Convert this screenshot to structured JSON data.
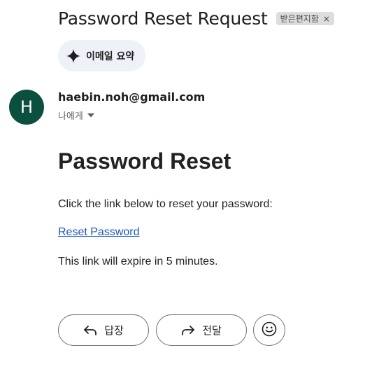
{
  "email": {
    "subject": "Password Reset Request",
    "label_chip": {
      "text": "받은편지함",
      "close_glyph": "×"
    },
    "summary_button": {
      "label": "이메일 요약",
      "icon": "sparkle-icon"
    },
    "sender": {
      "avatar_letter": "H",
      "avatar_color": "#0b4f3f",
      "email": "haebin.noh@gmail.com",
      "recipient_label": "나에게",
      "recipient_icon": "caret-down-icon"
    },
    "body": {
      "heading": "Password Reset",
      "intro": "Click the link below to reset your password:",
      "link_text": "Reset Password",
      "expiry_note": "This link will expire in 5 minutes."
    },
    "actions": {
      "reply_label": "답장",
      "reply_icon": "reply-icon",
      "forward_label": "전달",
      "forward_icon": "forward-icon",
      "emoji_icon": "smiley-icon"
    }
  },
  "colors": {
    "link": "#1a56c4",
    "summary_bg": "#eef2f8",
    "chip_bg": "#dddddd"
  }
}
